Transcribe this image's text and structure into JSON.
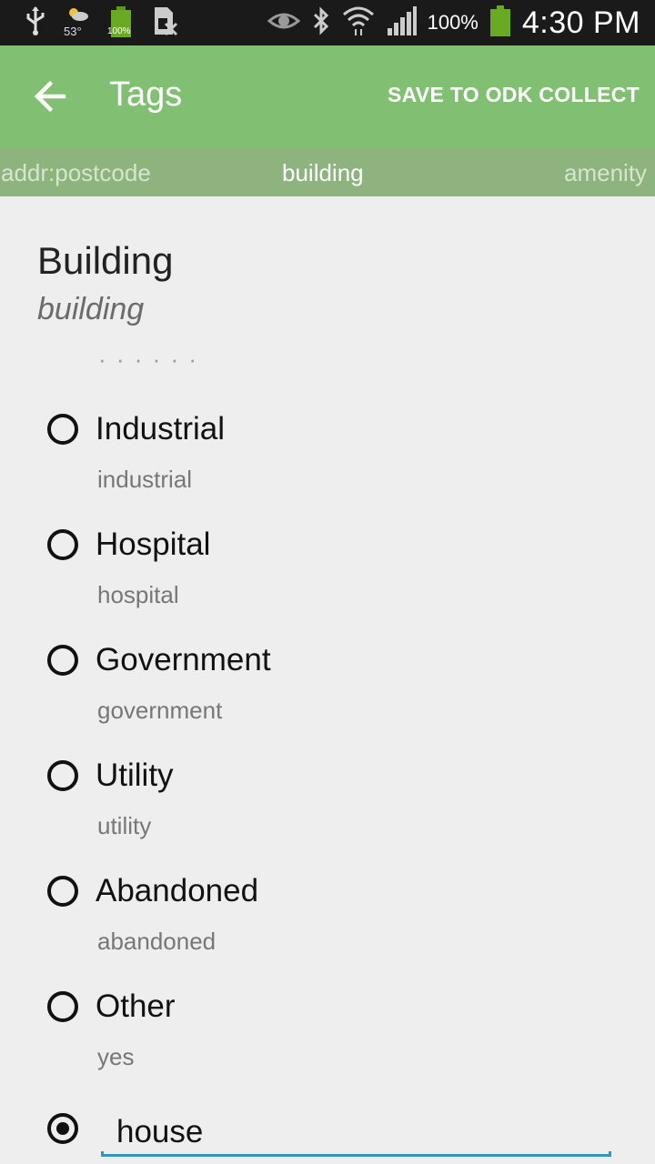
{
  "status_bar": {
    "temperature": "53°",
    "battery_small": "100%",
    "battery_percent": "100%",
    "time": "4:30 PM",
    "icons": [
      "usb-icon",
      "weather-icon",
      "battery-full-small-icon",
      "sim-icon",
      "eye-icon",
      "bluetooth-icon",
      "wifi-icon",
      "signal-icon",
      "battery-icon"
    ]
  },
  "toolbar": {
    "back_icon": "arrow-left-icon",
    "title": "Tags",
    "save_label": "SAVE TO ODK COLLECT"
  },
  "tag_tabs": {
    "previous": "addr:postcode",
    "current": "building",
    "next": "amenity"
  },
  "question": {
    "title": "Building",
    "key": "building"
  },
  "options": [
    {
      "label": "Industrial",
      "value": "industrial",
      "selected": false
    },
    {
      "label": "Hospital",
      "value": "hospital",
      "selected": false
    },
    {
      "label": "Government",
      "value": "government",
      "selected": false
    },
    {
      "label": "Utility",
      "value": "utility",
      "selected": false
    },
    {
      "label": "Abandoned",
      "value": "abandoned",
      "selected": false
    },
    {
      "label": "Other",
      "value": "yes",
      "selected": false
    }
  ],
  "custom_option": {
    "selected": true,
    "value": "house"
  },
  "colors": {
    "toolbar": "#81bf72",
    "tabs": "#8eb37f",
    "input_accent": "#2c9ab8"
  }
}
